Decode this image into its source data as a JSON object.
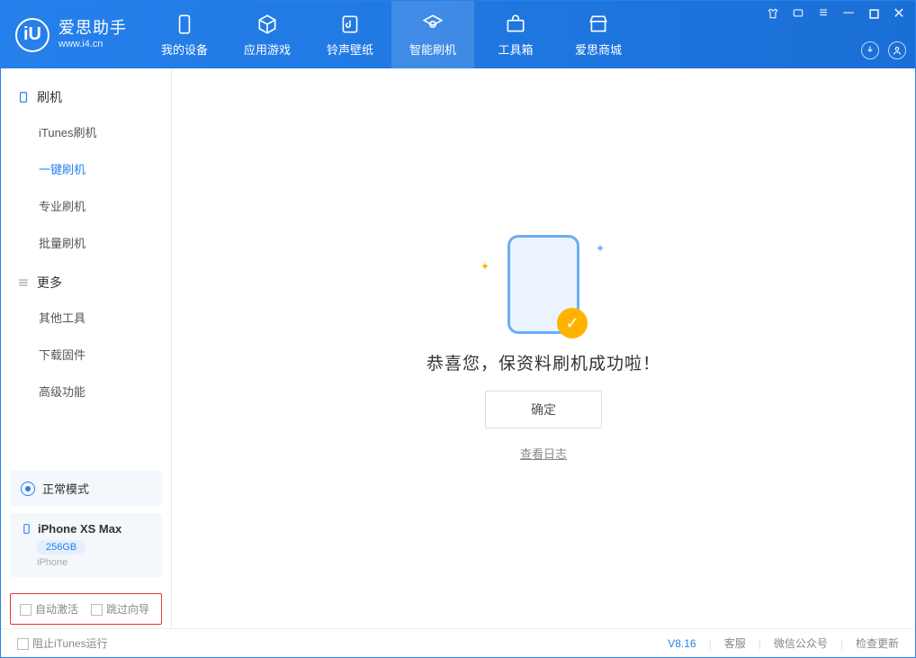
{
  "app": {
    "title": "爱思助手",
    "subtitle": "www.i4.cn"
  },
  "tabs": [
    {
      "id": "device",
      "label": "我的设备"
    },
    {
      "id": "apps",
      "label": "应用游戏"
    },
    {
      "id": "media",
      "label": "铃声壁纸"
    },
    {
      "id": "flash",
      "label": "智能刷机"
    },
    {
      "id": "tools",
      "label": "工具箱"
    },
    {
      "id": "store",
      "label": "爱思商城"
    }
  ],
  "sidebar": {
    "section1": {
      "title": "刷机"
    },
    "items1": [
      {
        "label": "iTunes刷机"
      },
      {
        "label": "一键刷机"
      },
      {
        "label": "专业刷机"
      },
      {
        "label": "批量刷机"
      }
    ],
    "section2": {
      "title": "更多"
    },
    "items2": [
      {
        "label": "其他工具"
      },
      {
        "label": "下载固件"
      },
      {
        "label": "高级功能"
      }
    ],
    "mode_label": "正常模式",
    "device": {
      "name": "iPhone XS Max",
      "capacity": "256GB",
      "type": "iPhone"
    },
    "checkbox1": "自动激活",
    "checkbox2": "跳过向导"
  },
  "main": {
    "success_title": "恭喜您，保资料刷机成功啦！",
    "ok_button": "确定",
    "view_log": "查看日志"
  },
  "footer": {
    "block_itunes": "阻止iTunes运行",
    "version": "V8.16",
    "link1": "客服",
    "link2": "微信公众号",
    "link3": "检查更新"
  }
}
